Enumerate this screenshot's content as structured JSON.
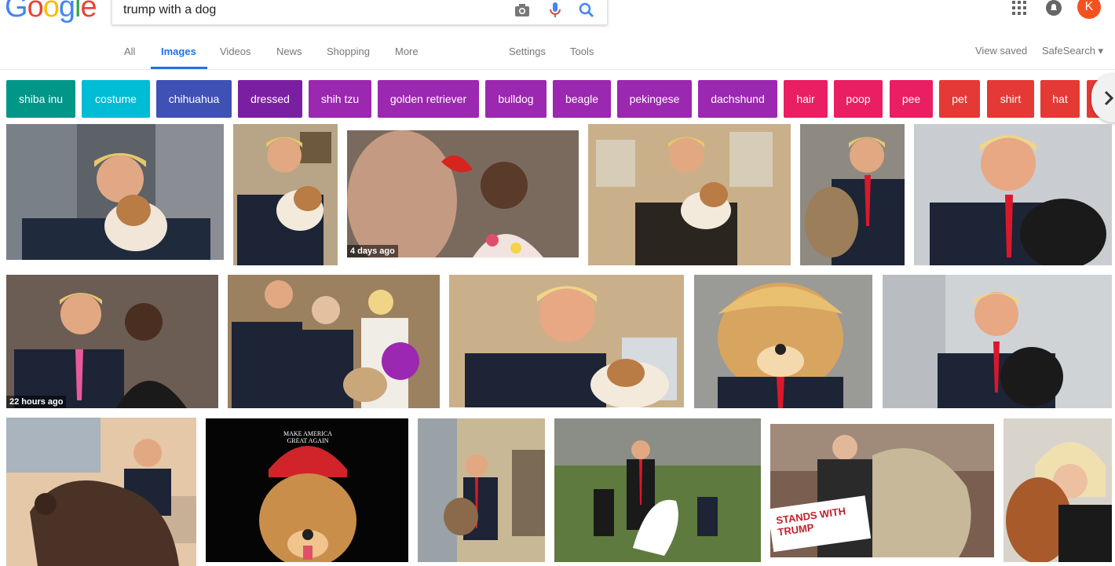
{
  "logo": [
    "G",
    "o",
    "o",
    "g",
    "l",
    "e"
  ],
  "logo_colors": [
    "#4285f4",
    "#ea4335",
    "#fbbc05",
    "#4285f4",
    "#34a853",
    "#ea4335"
  ],
  "search": {
    "value": "trump with a dog"
  },
  "icons": {
    "camera": "camera-icon",
    "mic": "microphone-icon",
    "search": "search-icon",
    "apps": "apps-grid-icon",
    "notifications": "notifications-icon",
    "account_initial": "K"
  },
  "tabs": {
    "all": "All",
    "images": "Images",
    "videos": "Videos",
    "news": "News",
    "shopping": "Shopping",
    "more": "More",
    "settings": "Settings",
    "tools": "Tools",
    "view_saved": "View saved",
    "safesearch": "SafeSearch ▾"
  },
  "colors": {
    "accent": "#1a73e8",
    "account": "#f4511e"
  },
  "chips": [
    {
      "label": "shiba inu",
      "color": "#009688"
    },
    {
      "label": "costume",
      "color": "#00bcd4"
    },
    {
      "label": "chihuahua",
      "color": "#3f51b5"
    },
    {
      "label": "dressed",
      "color": "#7b1fa2"
    },
    {
      "label": "shih tzu",
      "color": "#9c27b0"
    },
    {
      "label": "golden retriever",
      "color": "#9c27b0"
    },
    {
      "label": "bulldog",
      "color": "#9c27b0"
    },
    {
      "label": "beagle",
      "color": "#9c27b0"
    },
    {
      "label": "pekingese",
      "color": "#9c27b0"
    },
    {
      "label": "dachshund",
      "color": "#9c27b0"
    },
    {
      "label": "hair",
      "color": "#e91e63"
    },
    {
      "label": "poop",
      "color": "#e91e63"
    },
    {
      "label": "pee",
      "color": "#e91e63"
    },
    {
      "label": "pet",
      "color": "#e53935"
    },
    {
      "label": "shirt",
      "color": "#e53935"
    },
    {
      "label": "hat",
      "color": "#e53935"
    },
    {
      "label": "",
      "color": "#e53935"
    }
  ],
  "results": {
    "r1": {
      "timestamp": ""
    },
    "r3": {
      "timestamp": "4 days ago"
    },
    "r7": {
      "timestamp": "22 hours ago"
    },
    "r14": {
      "hat_text": "MAKE AMERICA GREAT AGAIN"
    },
    "r17": {
      "sign_text": "STANDS WITH TRUMP"
    }
  }
}
